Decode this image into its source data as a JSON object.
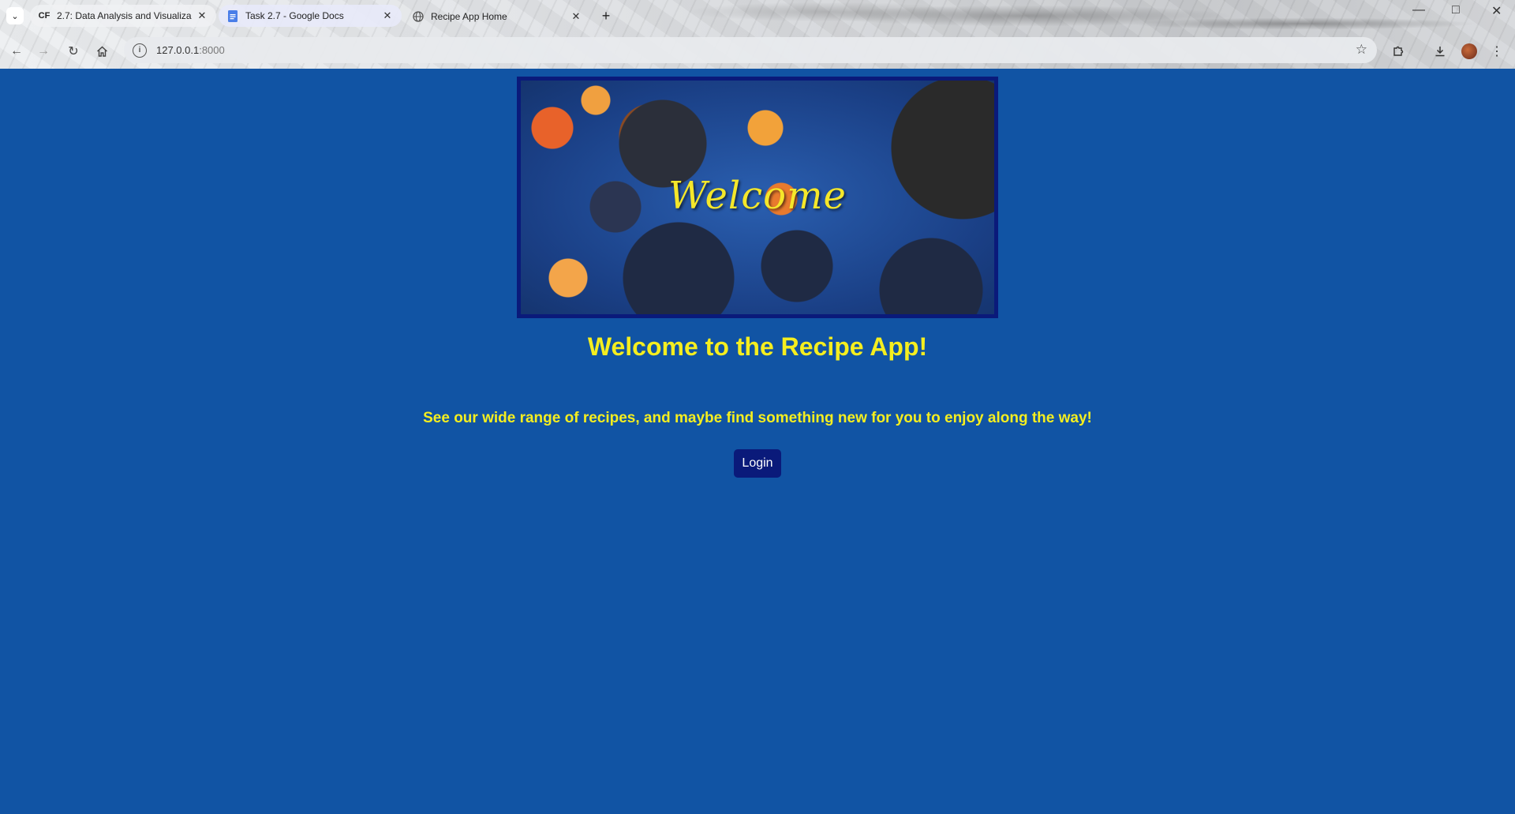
{
  "browser": {
    "tabs": [
      {
        "favicon": "CF",
        "title": "2.7: Data Analysis and Visualiza",
        "active": false
      },
      {
        "favicon": "docs-icon",
        "title": "Task 2.7 - Google Docs",
        "active": false
      },
      {
        "favicon": "globe-icon",
        "title": "Recipe App Home",
        "active": true
      }
    ],
    "url_host": "127.0.0.1",
    "url_port": ":8000"
  },
  "hero": {
    "overlay_text": "Welcome"
  },
  "main": {
    "title": "Welcome to the Recipe App!",
    "subtitle": "See our wide range of recipes, and maybe find something new for you to enjoy along the way!",
    "login_label": "Login"
  },
  "colors": {
    "page_background": "#1154a4",
    "heading_text": "#f5ee1f",
    "button_background": "#0a1a7a",
    "button_text": "#ffffff"
  }
}
